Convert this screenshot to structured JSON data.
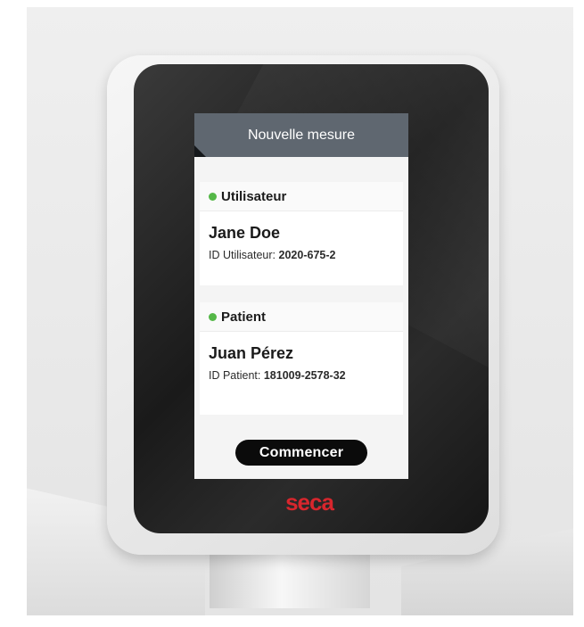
{
  "screen": {
    "header_title": "Nouvelle mesure",
    "user": {
      "section_label": "Utilisateur",
      "name": "Jane Doe",
      "id_label": "ID Utilisateur:",
      "id_value": "2020-675-2",
      "status_color": "#55b848"
    },
    "patient": {
      "section_label": "Patient",
      "name": "Juan Pérez",
      "id_label": "ID Patient:",
      "id_value": "181009-2578-32",
      "status_color": "#55b848"
    },
    "start_button_label": "Commencer"
  },
  "device": {
    "brand_logo": "seca",
    "brand_color": "#d8262d"
  }
}
